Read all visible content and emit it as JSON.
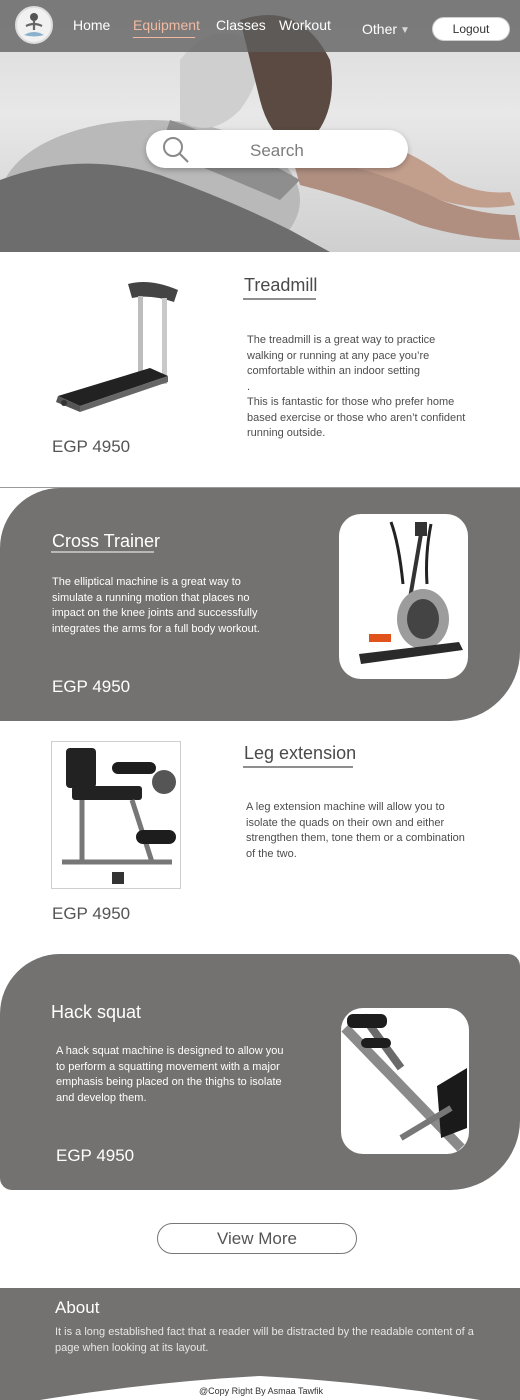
{
  "navbar": {
    "links": [
      "Home",
      "Equipment",
      "Classes",
      "Workout",
      "Other"
    ],
    "active": "Equipment",
    "logout_label": "Logout"
  },
  "search": {
    "placeholder": "Search"
  },
  "products": [
    {
      "title": "Treadmill",
      "description": "The treadmill is a great way to practice walking or running at any pace you’re comfortable within an indoor setting\n.\nThis is fantastic for those who prefer home based exercise or those who aren’t confident running outside.",
      "price": "EGP 4950"
    },
    {
      "title": "Cross Trainer",
      "description": "The elliptical machine is a great way to simulate a running motion that places no impact on the knee joints and successfully integrates the arms for a full body workout.",
      "price": "EGP 4950"
    },
    {
      "title": "Leg extension",
      "description": "A leg extension machine will allow you to isolate the quads on their own and either strengthen them, tone them or a combination of the two.",
      "price": "EGP 4950"
    },
    {
      "title": "Hack squat",
      "description": "A hack squat machine is designed to allow you to perform a squatting movement with a major emphasis being placed on the thighs to isolate and develop them.",
      "price": "EGP 4950"
    }
  ],
  "view_more_label": "View More",
  "footer": {
    "about_title": "About",
    "about_text": "It is a long established fact that a reader will be distracted by the readable content of a page when looking at its layout.",
    "copyright": "@Copy Right By Asmaa Tawfik"
  },
  "colors": {
    "nav_bg": "#5f5f5f",
    "active_link": "#f2b9a0",
    "card_dark": "#737271",
    "footer_bg": "#737271"
  },
  "icons": [
    "search-icon",
    "chevron-down-icon",
    "yoga-logo-icon"
  ]
}
